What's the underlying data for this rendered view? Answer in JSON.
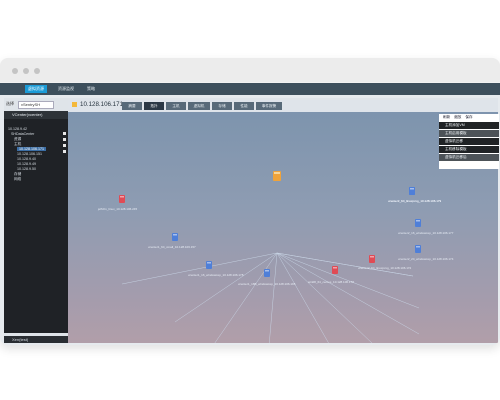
{
  "app": {
    "nav_tabs": [
      "虚拟资源",
      "资源监视",
      "策略"
    ],
    "selector_label": "选择",
    "selector_value": "vSentrySH",
    "tree_header": "VCenter(vcenter)",
    "tree": [
      "10.128.9.42",
      "SHDataCenter",
      "资源",
      "主机",
      "10.128.106.171",
      "10.128.106.151",
      "10.128.9.40",
      "10.128.9.49",
      "10.128.9.50",
      "存储",
      "网络"
    ],
    "footer_label": "Xen(test)"
  },
  "main": {
    "host_title": "10.128.106.171",
    "tabs": [
      "摘要",
      "拓扑",
      "主机",
      "虚拟机",
      "存储",
      "性能",
      "事件报警"
    ],
    "active_tab": "拓扑",
    "context_menu": {
      "header": [
        "刷新",
        "缩放",
        "保存"
      ],
      "items": [
        "主机添加VM",
        "主机启用模板",
        "虚拟机迁移",
        "主机移除模板",
        "虚拟机迁移后"
      ]
    }
  },
  "topology": {
    "center": {
      "label": "10.128.106.171",
      "color": "#f0a33a"
    },
    "nodes": [
      {
        "label": "jeffcfm_linux_10.128.106.245",
        "color": "#e04b55"
      },
      {
        "label": "vcenter1_64_vmall_10.128.106.157",
        "color": "#4f7fd8"
      },
      {
        "label": "vcenter1_16_windowsxp_10.128.106.178",
        "color": "#4f7fd8"
      },
      {
        "label": "vcenter1_16B_windowsxp_10.128.106.195",
        "color": "#4f7fd8"
      },
      {
        "label": "win08_64_centos_10.128.106.178",
        "color": "#e04b55"
      },
      {
        "label": "vcenter2_64_linuxpxxg_10.128.106.172",
        "color": "#e04b55"
      },
      {
        "label": "vcenter2_24_windowsxp_10.128.106.174",
        "color": "#4f7fd8"
      },
      {
        "label": "vcenter2_16_windowsxp_10.128.106.177",
        "color": "#4f7fd8"
      },
      {
        "label": "vcenter2_64_linuxpxxg_10.128.106.173",
        "color": "#4f7fd8"
      },
      {
        "label": "vcenter1_64_linuxpxxg_10.128.106.179",
        "color": "#4f7fd8"
      }
    ]
  }
}
